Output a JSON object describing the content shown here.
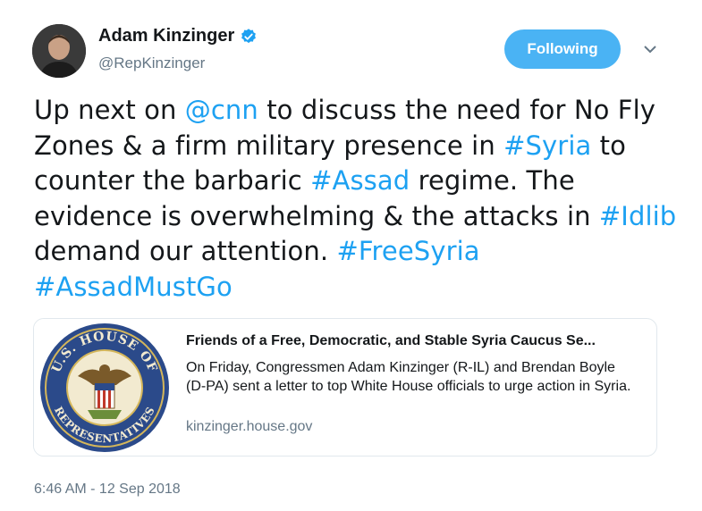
{
  "author": {
    "name": "Adam Kinzinger",
    "handle": "@RepKinzinger"
  },
  "follow_button": {
    "label": "Following"
  },
  "tweet": {
    "segments": [
      {
        "text": "Up next on ",
        "link": false
      },
      {
        "text": "@cnn",
        "link": true
      },
      {
        "text": " to discuss the need for No Fly Zones & a firm military presence in ",
        "link": false
      },
      {
        "text": "#Syria",
        "link": true
      },
      {
        "text": " to counter the barbaric ",
        "link": false
      },
      {
        "text": "#Assad",
        "link": true
      },
      {
        "text": " regime. The evidence is overwhelming & the attacks in ",
        "link": false
      },
      {
        "text": "#Idlib",
        "link": true
      },
      {
        "text": " demand our attention. ",
        "link": false
      },
      {
        "text": "#FreeSyria",
        "link": true
      },
      {
        "text": " ",
        "link": false
      },
      {
        "text": "#AssadMustGo",
        "link": true
      }
    ]
  },
  "card": {
    "title": "Friends of a Free, Democratic, and Stable Syria Caucus Se...",
    "description": "On Friday, Congressmen Adam Kinzinger (R-IL) and Brendan Boyle (D-PA) sent a letter to top White House officials to urge action in Syria.",
    "domain": "kinzinger.house.gov",
    "seal_text_top": "U.S. HOUSE OF",
    "seal_text_bottom": "REPRESENTATIVES"
  },
  "timestamp": "6:46 AM - 12 Sep 2018",
  "colors": {
    "link": "#1da1f2",
    "button": "#4ab3f4",
    "muted": "#657786",
    "seal_blue": "#2b4a8a"
  }
}
